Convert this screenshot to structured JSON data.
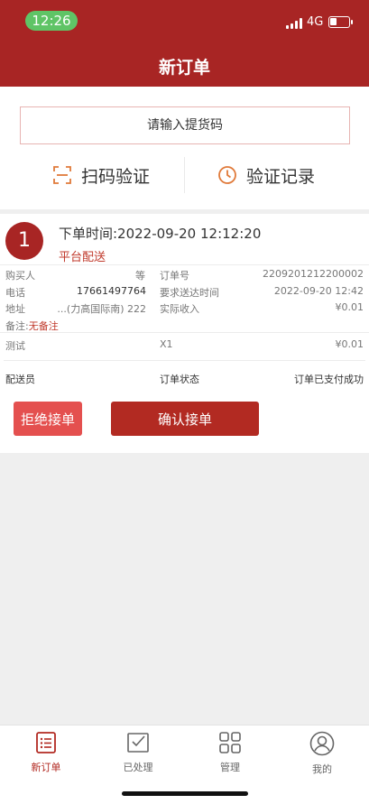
{
  "status_bar": {
    "time": "12:26",
    "network": "4G"
  },
  "header": {
    "title": "新订单"
  },
  "pickup": {
    "placeholder": "请输入提货码"
  },
  "actions": {
    "scan_label": "扫码验证",
    "records_label": "验证记录"
  },
  "order": {
    "index": "1",
    "order_time": "下单时间:2022-09-20 12:12:20",
    "delivery_type": "平台配送",
    "buyer_label": "购买人",
    "buyer_value": "等",
    "order_no_label": "订单号",
    "order_no_value": "2209201212200002",
    "phone_label": "电话",
    "phone_value": "17661497764",
    "deliver_time_label": "要求送达时间",
    "deliver_time_value": "2022-09-20 12:42",
    "address_label": "地址",
    "address_value": "...(力高国际南) 222",
    "income_label": "实际收入",
    "income_value": "¥0.01",
    "remark_label": "备注:",
    "remark_value": "无备注",
    "item_name": "测试",
    "item_qty": "X1",
    "item_price": "¥0.01",
    "courier_label": "配送员",
    "status_label": "订单状态",
    "status_value": "订单已支付成功",
    "reject_label": "拒绝接单",
    "confirm_label": "确认接单"
  },
  "tabs": [
    {
      "label": "新订单",
      "icon": "order-list-icon"
    },
    {
      "label": "已处理",
      "icon": "processed-box-icon"
    },
    {
      "label": "管理",
      "icon": "grid-icon"
    },
    {
      "label": "我的",
      "icon": "user-icon"
    }
  ],
  "colors": {
    "brand": "#a82524",
    "accent": "#e4504f",
    "status_green": "#5fc466"
  }
}
